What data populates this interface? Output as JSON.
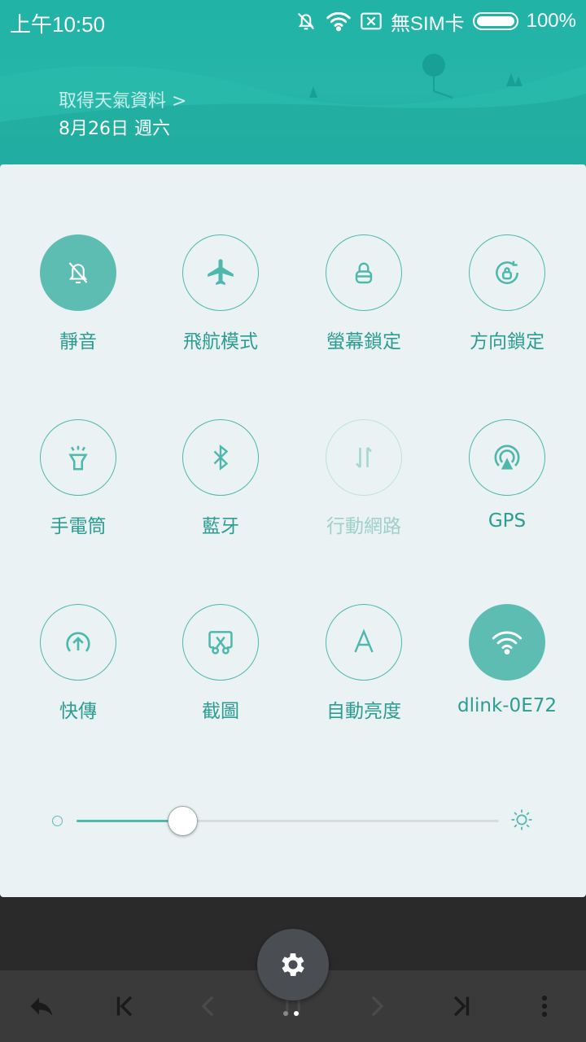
{
  "status_bar": {
    "time": "上午10:50",
    "sim_text": "無SIM卡",
    "battery_pct": "100%",
    "battery_level": 1.0,
    "icons": [
      "mute-icon",
      "wifi-icon",
      "no-sim-icon",
      "battery-icon"
    ]
  },
  "header": {
    "weather_link": "取得天氣資料 >",
    "date": "8月26日 週六"
  },
  "tiles": [
    {
      "label": "靜音",
      "icon": "bell-off-icon",
      "state": "active"
    },
    {
      "label": "飛航模式",
      "icon": "airplane-icon",
      "state": "off"
    },
    {
      "label": "螢幕鎖定",
      "icon": "lock-icon",
      "state": "off"
    },
    {
      "label": "方向鎖定",
      "icon": "rotation-lock-icon",
      "state": "off"
    },
    {
      "label": "手電筒",
      "icon": "flashlight-icon",
      "state": "off"
    },
    {
      "label": "藍牙",
      "icon": "bluetooth-icon",
      "state": "off"
    },
    {
      "label": "行動網路",
      "icon": "mobile-data-icon",
      "state": "disabled"
    },
    {
      "label": "GPS",
      "icon": "gps-icon",
      "state": "off"
    },
    {
      "label": "快傳",
      "icon": "quick-share-icon",
      "state": "off"
    },
    {
      "label": "截圖",
      "icon": "screenshot-icon",
      "state": "off"
    },
    {
      "label": "自動亮度",
      "icon": "auto-brightness-icon",
      "state": "off"
    },
    {
      "label": "dlink-0E72",
      "icon": "wifi-icon",
      "state": "active"
    }
  ],
  "brightness": {
    "level": 0.25
  },
  "colors": {
    "accent": "#4fb8ad",
    "active_fill": "#5ebdb3",
    "header": "#22b3a6",
    "panel": "#eaf2f3"
  },
  "bottom_bar": {
    "buttons": [
      "reply-icon",
      "first-page-icon",
      "prev-icon",
      "page-icon",
      "next-icon",
      "last-page-icon",
      "more-icon"
    ],
    "settings": "gear-icon",
    "pages": 2,
    "current_page": 2
  }
}
